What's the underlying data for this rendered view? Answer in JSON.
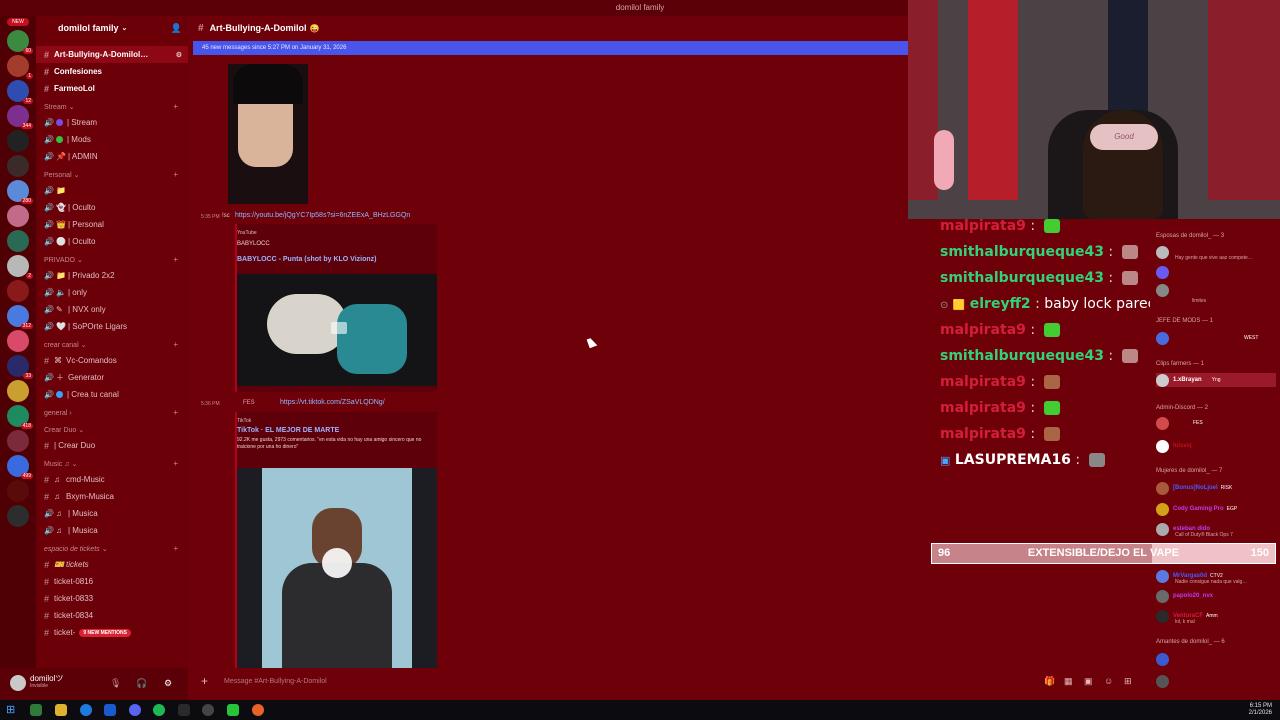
{
  "window": {
    "title": "domilol family"
  },
  "server": {
    "name": "domilol family"
  },
  "channels": {
    "top": [
      {
        "name": "Art-Bullying-A-Domilol…",
        "selected": true
      },
      {
        "name": "Confesiones",
        "bold": true
      },
      {
        "name": "FarmeoLol",
        "bold": true
      }
    ],
    "categories": [
      {
        "name": "Stream",
        "items": [
          "| Stream",
          "| Mods",
          "| ADMIN"
        ]
      },
      {
        "name": "Personal",
        "items": [
          "",
          "| Oculto",
          "| Personal",
          "| Oculto"
        ]
      },
      {
        "name": "PRIVADO",
        "items": [
          "| Privado 2x2",
          "| only",
          "| NVX only",
          "| SoPOrte Ligars"
        ]
      },
      {
        "name": "crear canal",
        "items": [
          "Vc-Comandos",
          "Generator",
          "| Crea tu canal"
        ]
      },
      {
        "name": "general",
        "items": []
      },
      {
        "name": "Crear Duo",
        "items": [
          "| Crear Duo"
        ]
      },
      {
        "name": "Music",
        "items": [
          "cmd-Music",
          "Bxym-Musica",
          "| Musica",
          "| Musica"
        ]
      },
      {
        "name": "espacio de tickets",
        "items": [
          "tickets",
          "ticket-0816",
          "ticket-0833",
          "ticket-0834",
          "ticket-"
        ]
      }
    ],
    "mentions_pill": "9 NEW MENTIONS"
  },
  "user": {
    "name": "domilolツ",
    "status": "Invisible"
  },
  "chat": {
    "channel_name": "Art-Bullying-A-Domilol",
    "new_messages_bar": "45 new messages since 5:27 PM on January 31, 2026",
    "msg1": {
      "time": "5:35 PM",
      "author": "!sc",
      "link": "https://youtu.be/jQgYC7Ip58s?si=6nZEExA_BHzLGGQn"
    },
    "embed1": {
      "provider": "YouTube",
      "author": "BABYLOCC",
      "title": "BABYLOCC - Punta (shot by KLO Vizionz)"
    },
    "msg2": {
      "time": "5:36 PM",
      "author": "FES",
      "link": "https://vt.tiktok.com/ZSaVLQDNg/"
    },
    "embed2": {
      "provider": "TikTok",
      "title": "TikTok · EL MEJOR DE MARTE",
      "description": "92.2K me gusta, 2973 comentarios. \"en esta vida no hay una amigo sincero que no traicione por una ho dinero\""
    },
    "input_placeholder": "Message #Art-Bullying-A-Domilol"
  },
  "overlay_chat": [
    {
      "name": "malpirata9",
      "color": "#d41e3a"
    },
    {
      "name": "smithalburqueque43",
      "color": "#33d17a"
    },
    {
      "name": "smithalburqueque43",
      "color": "#33d17a"
    },
    {
      "name": "elreyff2",
      "color": "#33d17a",
      "text": "baby lock parece un ratón"
    },
    {
      "name": "malpirata9",
      "color": "#d41e3a"
    },
    {
      "name": "smithalburqueque43",
      "color": "#33d17a"
    },
    {
      "name": "malpirata9",
      "color": "#d41e3a"
    },
    {
      "name": "malpirata9",
      "color": "#d41e3a"
    },
    {
      "name": "malpirata9",
      "color": "#d41e3a"
    },
    {
      "name": "LASUPREMA16",
      "color": "#ffffff"
    }
  ],
  "members": {
    "cat1": "Esposas de domilol_ — 3",
    "cat1_sub": "Hay gente que vive aaz compete…",
    "cat1_sub2": "limites",
    "cat2": "JEFE DE MODS — 1",
    "cat2_badge": "WEST",
    "cat3": "Clips farmers — 1",
    "cat3_user": "1.xBrayan",
    "cat3_tag": "Yng",
    "cat4": "Admin-Discord — 2",
    "cat4_user_tag": "FES",
    "cat4_user2": "luisvxj",
    "cat5": "Mujeres de domilol_ — 7",
    "cat5_users": [
      "[Bonus]NoLjoel",
      "Cody Gaming Pro",
      "esteban dido",
      "",
      "MrVargas0d",
      "papolo20_nvx",
      "VenturaCF"
    ],
    "cat5_tags": [
      "RISK",
      "EGP",
      "",
      "",
      "CTV2",
      "",
      "Amm"
    ],
    "cat5_subs": [
      "",
      "",
      "Call of Duty® Black Ops 7",
      "",
      "Nadie consigue nada que valg…",
      "",
      "lol, k mal"
    ],
    "cat6": "Amantes de domilol_ — 6"
  },
  "goal_bar": {
    "left": "96",
    "label": "EXTENSIBLE/DEJO EL VAPE",
    "right": "150",
    "progress": 0.64
  },
  "tray": {
    "time": "6:15 PM",
    "date": "2/1/2026"
  },
  "colors": {
    "bg": "#6d0008",
    "sidebar": "#6b0009",
    "accent": "#4955ea"
  }
}
